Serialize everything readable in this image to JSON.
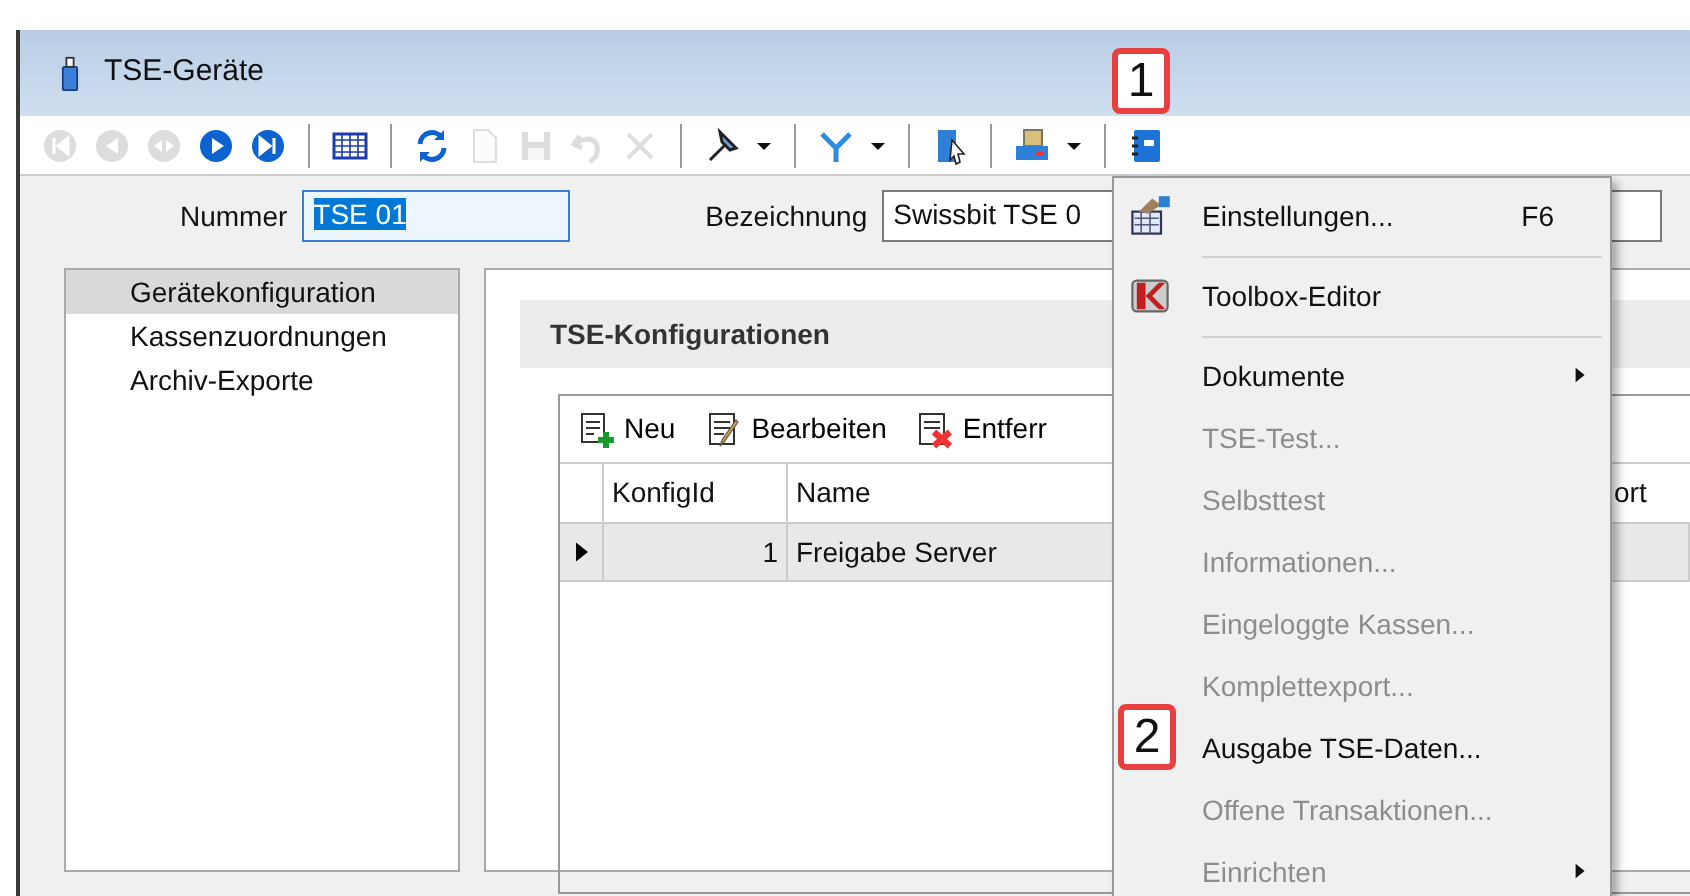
{
  "window": {
    "title": "TSE-Geräte"
  },
  "toolbar": [
    {
      "kind": "button",
      "disabled": true
    },
    {
      "kind": "button",
      "disabled": true
    },
    {
      "kind": "button",
      "disabled": true
    },
    {
      "kind": "button",
      "disabled": false
    },
    {
      "kind": "button",
      "disabled": false
    },
    {
      "kind": "separator"
    },
    {
      "kind": "button",
      "disabled": false
    },
    {
      "kind": "separator"
    },
    {
      "kind": "button",
      "disabled": false
    },
    {
      "kind": "button",
      "disabled": true
    },
    {
      "kind": "button",
      "disabled": true
    },
    {
      "kind": "button",
      "disabled": true
    },
    {
      "kind": "button",
      "disabled": true
    },
    {
      "kind": "separator"
    },
    {
      "kind": "button",
      "disabled": false
    },
    {
      "kind": "dropdown"
    },
    {
      "kind": "separator"
    },
    {
      "kind": "button",
      "disabled": false
    },
    {
      "kind": "dropdown"
    },
    {
      "kind": "separator"
    },
    {
      "kind": "button",
      "disabled": false
    },
    {
      "kind": "separator"
    },
    {
      "kind": "button",
      "disabled": false
    },
    {
      "kind": "dropdown"
    },
    {
      "kind": "separator"
    },
    {
      "kind": "button",
      "disabled": false
    }
  ],
  "fields": [
    {
      "label": "Nummer",
      "value": "TSE 01",
      "selected": true
    },
    {
      "label": "Bezeichnung",
      "value": "Swissbit TSE 0",
      "selected": false
    }
  ],
  "sidebar": {
    "items": [
      {
        "label": "Gerätekonfiguration",
        "selected": true
      },
      {
        "label": "Kassenzuordnungen",
        "selected": false
      },
      {
        "label": "Archiv-Exporte",
        "selected": false
      }
    ]
  },
  "section": {
    "title": "TSE-Konfigurationen"
  },
  "grid_toolbar": [
    {
      "label": "Neu"
    },
    {
      "label": "Bearbeiten"
    },
    {
      "label": "Entferr"
    }
  ],
  "table": {
    "columns": [
      "KonfigId",
      "Name",
      "ort"
    ],
    "rows": [
      {
        "current": true,
        "cells": [
          "1",
          "Freigabe Server"
        ]
      }
    ]
  },
  "menu": [
    {
      "kind": "item",
      "label": "Einstellungen...",
      "shortcut": "F6",
      "disabled": false,
      "submenu": false
    },
    {
      "kind": "separator"
    },
    {
      "kind": "item",
      "label": "Toolbox-Editor",
      "disabled": false,
      "submenu": false
    },
    {
      "kind": "separator"
    },
    {
      "kind": "item",
      "label": "Dokumente",
      "disabled": false,
      "submenu": true
    },
    {
      "kind": "item",
      "label": "TSE-Test...",
      "disabled": true,
      "submenu": false
    },
    {
      "kind": "item",
      "label": "Selbsttest",
      "disabled": true,
      "submenu": false
    },
    {
      "kind": "item",
      "label": "Informationen...",
      "disabled": true,
      "submenu": false
    },
    {
      "kind": "item",
      "label": "Eingeloggte Kassen...",
      "disabled": true,
      "submenu": false
    },
    {
      "kind": "item",
      "label": "Komplettexport...",
      "disabled": true,
      "submenu": false
    },
    {
      "kind": "item",
      "label": "Ausgabe TSE-Daten...",
      "disabled": false,
      "submenu": false
    },
    {
      "kind": "item",
      "label": "Offene Transaktionen...",
      "disabled": true,
      "submenu": false
    },
    {
      "kind": "item",
      "label": "Einrichten",
      "disabled": true,
      "submenu": true
    }
  ],
  "callouts": [
    {
      "label": "1"
    },
    {
      "label": "2"
    }
  ]
}
